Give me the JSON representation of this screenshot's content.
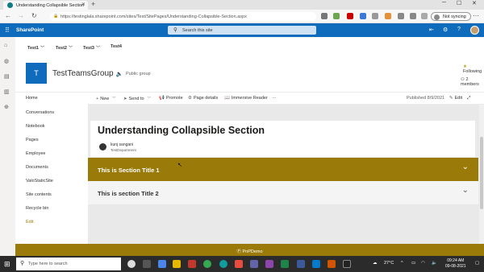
{
  "browser": {
    "tab_title": "Understanding Collapsible Section",
    "url": "https://testinglala.sharepoint.com/sites/Test/SitePages/Understanding-Collapsible-Section.aspx",
    "sync_label": "Not syncing"
  },
  "suite": {
    "brand": "SharePoint",
    "search_placeholder": "Search this site"
  },
  "hubnav": {
    "items": [
      "Test1",
      "Test2",
      "Test3",
      "Test4"
    ]
  },
  "site": {
    "logo_letter": "T",
    "title": "TestTeamsGroup",
    "group_type": "Public group",
    "following": "Following",
    "members": "2 members"
  },
  "quicklaunch": {
    "items": [
      "Home",
      "Conversations",
      "Notebook",
      "Pages",
      "Employee",
      "Documents",
      "ValoStaticSite",
      "Site contents",
      "Recycle bin",
      "Edit"
    ]
  },
  "commandbar": {
    "new": "New",
    "send_to": "Send to",
    "promote": "Promote",
    "page_details": "Page details",
    "immersive_reader": "Immersive Reader",
    "more": "···",
    "published": "Published 8/9/2021",
    "edit": "Edit"
  },
  "page": {
    "title": "Understanding Collapsible Section",
    "author_name": "kunj sangani",
    "author_dept": "TestDepartment",
    "sections": [
      {
        "title": "This is Section Title 1",
        "expanded": false
      },
      {
        "title": "This is section Title 2",
        "expanded": false
      }
    ]
  },
  "footer": {
    "text": "Ⓟ PnPDemo"
  },
  "taskbar": {
    "search_placeholder": "Type here to search",
    "temperature": "27°C",
    "time": "09:24 AM",
    "date": "09-08-2021"
  },
  "colors": {
    "suite_blue": "#0f6cbd",
    "theme_gold": "#9a7b0a"
  }
}
